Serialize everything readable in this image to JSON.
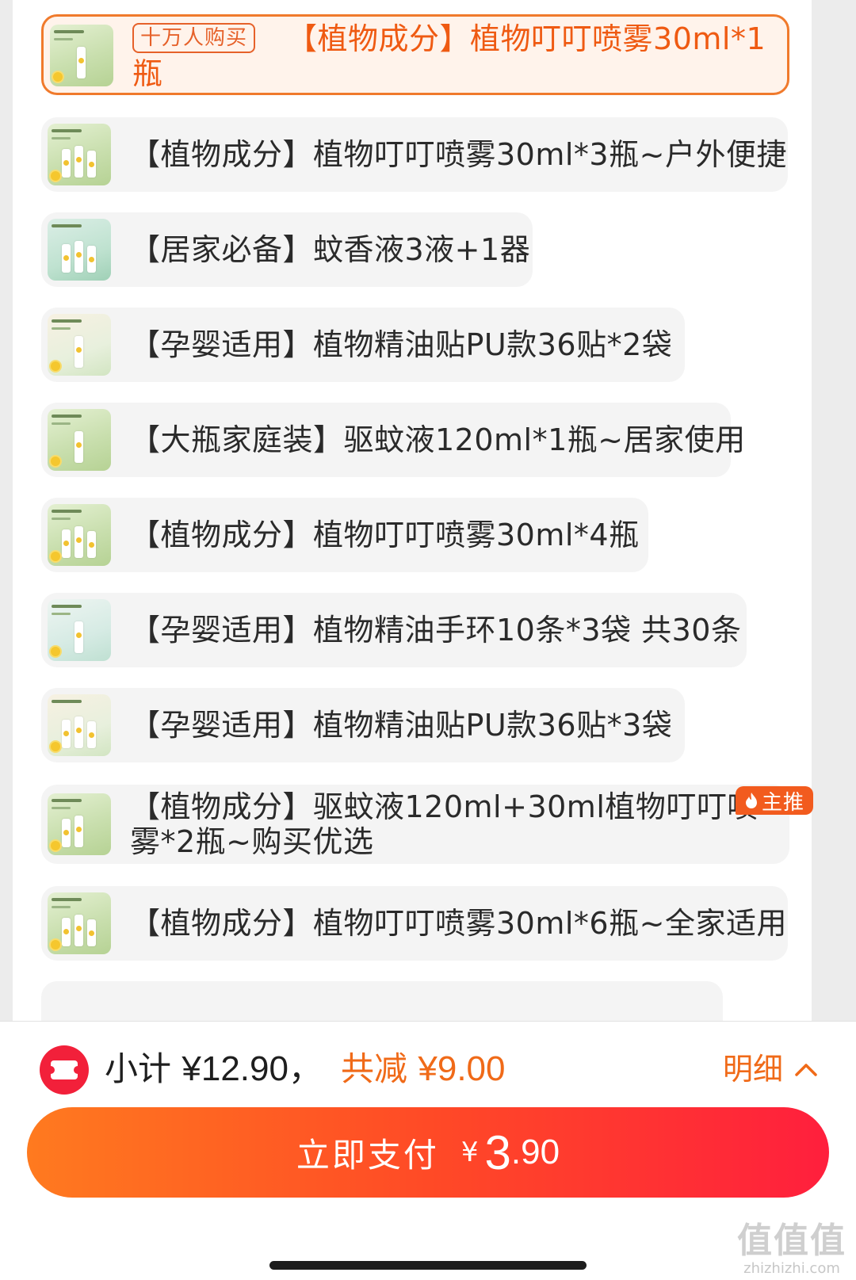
{
  "options": [
    {
      "badge": "十万人购买",
      "label": "【植物成分】植物叮叮喷雾30ml*1瓶",
      "selected": true
    },
    {
      "label": "【植物成分】植物叮叮喷雾30ml*3瓶~户外便捷"
    },
    {
      "label": "【居家必备】蚊香液3液+1器"
    },
    {
      "label": "【孕婴适用】植物精油贴PU款36贴*2袋"
    },
    {
      "label": "【大瓶家庭装】驱蚊液120ml*1瓶~居家使用"
    },
    {
      "label": "【植物成分】植物叮叮喷雾30ml*4瓶"
    },
    {
      "label": "【孕婴适用】植物精油手环10条*3袋 共30条"
    },
    {
      "label": "【孕婴适用】植物精油贴PU款36贴*3袋"
    },
    {
      "label": "【植物成分】驱蚊液120ml+30ml植物叮叮喷雾*2瓶~购买优选",
      "tag": "主推"
    },
    {
      "label": "【植物成分】植物叮叮喷雾30ml*6瓶~全家适用"
    }
  ],
  "summary": {
    "subtotal_label": "小计",
    "subtotal_amount": "¥12.90",
    "separator": "，",
    "discount_label": "共减",
    "discount_amount": "¥9.00",
    "detail_label": "明细"
  },
  "pay": {
    "label": "立即支付",
    "currency": "¥",
    "amount_int": "3",
    "amount_dec": ".90"
  },
  "watermark": {
    "main": "值值值",
    "domain": "zhizhizhi.com"
  },
  "colors": {
    "accent": "#f06a18",
    "pay_gradient_start": "#ff7a1f",
    "pay_gradient_end": "#ff1f3d",
    "coupon": "#f2203a"
  }
}
